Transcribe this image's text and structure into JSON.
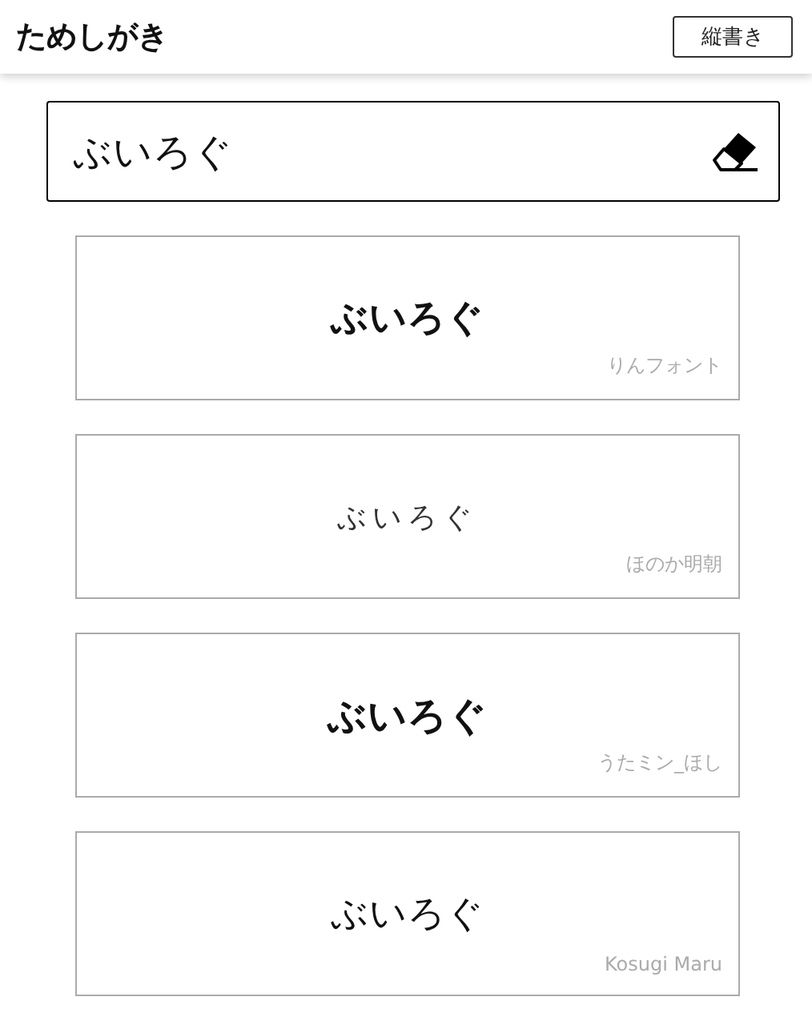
{
  "app_bar": {
    "title": "ためしがき",
    "vertical_button": "縦書き"
  },
  "input": {
    "value": "ぶいろぐ"
  },
  "samples": [
    {
      "text": "ぶいろぐ",
      "font_name": "りんフォント"
    },
    {
      "text": "ぶいろぐ",
      "font_name": "ほのか明朝"
    },
    {
      "text": "ぶいろぐ",
      "font_name": "うたミン_ほし"
    },
    {
      "text": "ぶいろぐ",
      "font_name": "Kosugi Maru"
    }
  ]
}
